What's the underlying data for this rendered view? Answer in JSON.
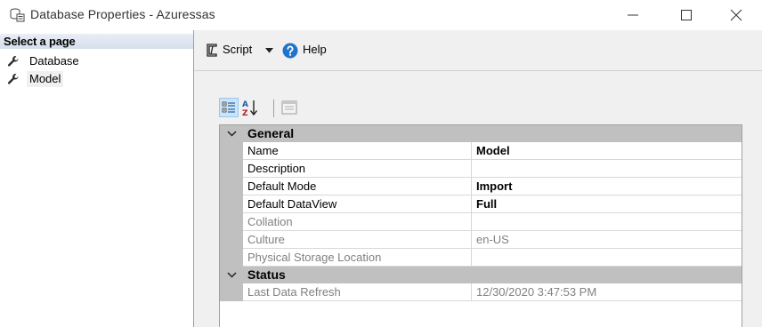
{
  "window": {
    "title": "Database Properties - Azuressas",
    "icons": {
      "app": "database-properties-icon",
      "minimize": "minimize-icon",
      "maximize": "maximize-icon",
      "close": "close-icon"
    }
  },
  "sidebar": {
    "header": "Select a page",
    "items": [
      {
        "label": "Database",
        "icon": "wrench-icon",
        "selected": false
      },
      {
        "label": "Model",
        "icon": "wrench-icon",
        "selected": true
      }
    ]
  },
  "toolbar": {
    "script_label": "Script",
    "help_label": "Help"
  },
  "grid_toolbar": {
    "buttons": [
      "categorized-view-icon",
      "alphabetical-sort-icon",
      "property-pages-icon"
    ]
  },
  "property_grid": {
    "categories": [
      {
        "name": "General",
        "properties": [
          {
            "name": "Name",
            "value": "Model",
            "bold": true,
            "readonly": false
          },
          {
            "name": "Description",
            "value": "",
            "bold": false,
            "readonly": false
          },
          {
            "name": "Default Mode",
            "value": "Import",
            "bold": true,
            "readonly": false
          },
          {
            "name": "Default DataView",
            "value": "Full",
            "bold": true,
            "readonly": false
          },
          {
            "name": "Collation",
            "value": "",
            "bold": false,
            "readonly": true
          },
          {
            "name": "Culture",
            "value": "en-US",
            "bold": false,
            "readonly": true
          },
          {
            "name": "Physical Storage Location",
            "value": "",
            "bold": false,
            "readonly": true
          }
        ]
      },
      {
        "name": "Status",
        "properties": [
          {
            "name": "Last Data Refresh",
            "value": "12/30/2020 3:47:53 PM",
            "bold": false,
            "readonly": true
          }
        ]
      }
    ]
  },
  "colors": {
    "category_band": "#c0c0c0",
    "selected_grid_button": "#cce4f7",
    "help_icon": "#1e74c8",
    "readonly_text": "#808080"
  }
}
